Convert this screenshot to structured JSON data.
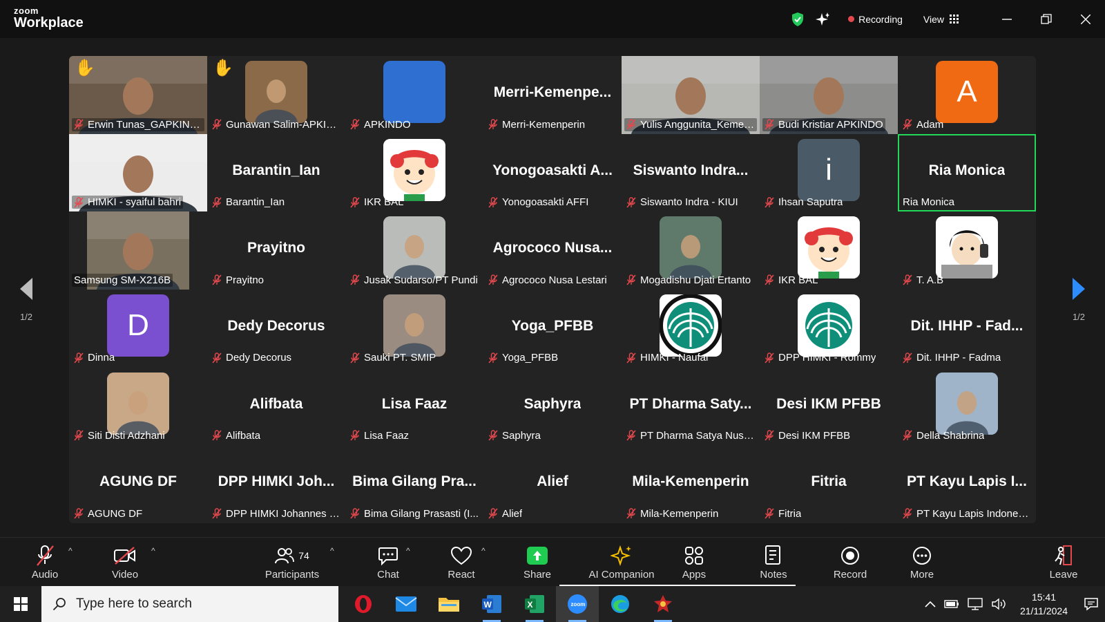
{
  "titlebar": {
    "logo_small": "zoom",
    "logo_big": "Workplace",
    "recording": "Recording",
    "view": "View"
  },
  "nav": {
    "page_left": "1/2",
    "page_right": "1/2"
  },
  "tiles": [
    {
      "name": "Erwin Tunas_GAPKINDO",
      "type": "video",
      "bg": "#6b5a4a",
      "hand": true
    },
    {
      "name": "Gunawan Salim-APKINDO",
      "type": "photo",
      "bg": "#8a6a48",
      "hand": true
    },
    {
      "name": "APKINDO",
      "type": "avatar",
      "bg": "#2f6fd1",
      "letter": ""
    },
    {
      "name": "Merri-Kemenperin",
      "type": "text",
      "label": "Merri-Kemenpe..."
    },
    {
      "name": "Yulis Anggunita_Kemenperin",
      "type": "video",
      "bg": "#b7b7b4"
    },
    {
      "name": "Budi Kristiar APKINDO",
      "type": "video",
      "bg": "#8d8e8c"
    },
    {
      "name": "Adam",
      "type": "avatar",
      "bg": "#f06a13",
      "letter": "A"
    },
    {
      "name": "HIMKI - syaiful bahri",
      "type": "video",
      "bg": "#ececec"
    },
    {
      "name": "Barantin_Ian",
      "type": "text",
      "label": "Barantin_Ian"
    },
    {
      "name": "IKR BAL",
      "type": "mascot"
    },
    {
      "name": "Yonogoasakti AFFI",
      "type": "text",
      "label": "Yonogoasakti A..."
    },
    {
      "name": "Siswanto Indra - KIUI",
      "type": "text",
      "label": "Siswanto Indra..."
    },
    {
      "name": "Ihsan Saputra",
      "type": "avatar",
      "bg": "#4a5a66",
      "letter": "i"
    },
    {
      "name": "Ria Monica",
      "type": "text",
      "label": "Ria Monica",
      "active": true
    },
    {
      "name": "Samsung SM-X216B",
      "type": "video-narrow",
      "bg": "#7a7060"
    },
    {
      "name": "Prayitno",
      "type": "text",
      "label": "Prayitno"
    },
    {
      "name": "Jusak Sudarso/PT Pundi",
      "type": "photo",
      "bg": "#b9bcb9"
    },
    {
      "name": "Agrococo Nusa Lestari",
      "type": "text",
      "label": "Agrococo Nusa..."
    },
    {
      "name": "Mogadishu Djati Ertanto",
      "type": "photo",
      "bg": "#5f7a6a"
    },
    {
      "name": "IKR BAL",
      "type": "mascot"
    },
    {
      "name": "T. A.B",
      "type": "cartoon"
    },
    {
      "name": "Dinna",
      "type": "avatar",
      "bg": "#7a4fd0",
      "letter": "D"
    },
    {
      "name": "Dedy Decorus",
      "type": "text",
      "label": "Dedy Decorus"
    },
    {
      "name": "Sauki PT. SMIP",
      "type": "photo",
      "bg": "#9a8c80"
    },
    {
      "name": "Yoga_PFBB",
      "type": "text",
      "label": "Yoga_PFBB"
    },
    {
      "name": "HIMKI - Naufal",
      "type": "himki",
      "ring": true
    },
    {
      "name": "DPP HIMKI - Rommy",
      "type": "himki",
      "ring": false
    },
    {
      "name": "Dit. IHHP - Fadma",
      "type": "text",
      "label": "Dit. IHHP - Fad..."
    },
    {
      "name": "Siti Disti Adzhani",
      "type": "photo",
      "bg": "#c9a888"
    },
    {
      "name": "Alifbata",
      "type": "text",
      "label": "Alifbata"
    },
    {
      "name": "Lisa Faaz",
      "type": "text",
      "label": "Lisa Faaz"
    },
    {
      "name": "Saphyra",
      "type": "text",
      "label": "Saphyra"
    },
    {
      "name": "PT Dharma Satya Nusantara",
      "type": "text",
      "label": "PT Dharma Saty..."
    },
    {
      "name": "Desi IKM PFBB",
      "type": "text",
      "label": "Desi IKM PFBB"
    },
    {
      "name": "Della Shabrina",
      "type": "photo",
      "bg": "#9fb4c8"
    },
    {
      "name": "AGUNG DF",
      "type": "text",
      "label": "AGUNG DF"
    },
    {
      "name": "DPP HIMKI Johannes B...",
      "type": "text",
      "label": "DPP HIMKI Joh..."
    },
    {
      "name": "Bima Gilang Prasasti (I...",
      "type": "text",
      "label": "Bima Gilang Pra..."
    },
    {
      "name": "Alief",
      "type": "text",
      "label": "Alief"
    },
    {
      "name": "Mila-Kemenperin",
      "type": "text",
      "label": "Mila-Kemenperin"
    },
    {
      "name": "Fitria",
      "type": "text",
      "label": "Fitria"
    },
    {
      "name": "PT Kayu Lapis Indonesia",
      "type": "text",
      "label": "PT Kayu Lapis I..."
    }
  ],
  "toolbar": {
    "audio": "Audio",
    "video": "Video",
    "participants": "Participants",
    "participants_count": "74",
    "chat": "Chat",
    "react": "React",
    "share": "Share",
    "ai_companion": "AI Companion",
    "apps": "Apps",
    "notes": "Notes",
    "record": "Record",
    "more": "More",
    "leave": "Leave"
  },
  "taskbar": {
    "search_placeholder": "Type here to search",
    "time": "15:41",
    "date": "21/11/2024"
  },
  "colors": {
    "active_speaker": "#23d959",
    "recording_dot": "#e5484d",
    "share_green": "#1fcb50",
    "nav_arrow_right": "#2d8cff"
  }
}
